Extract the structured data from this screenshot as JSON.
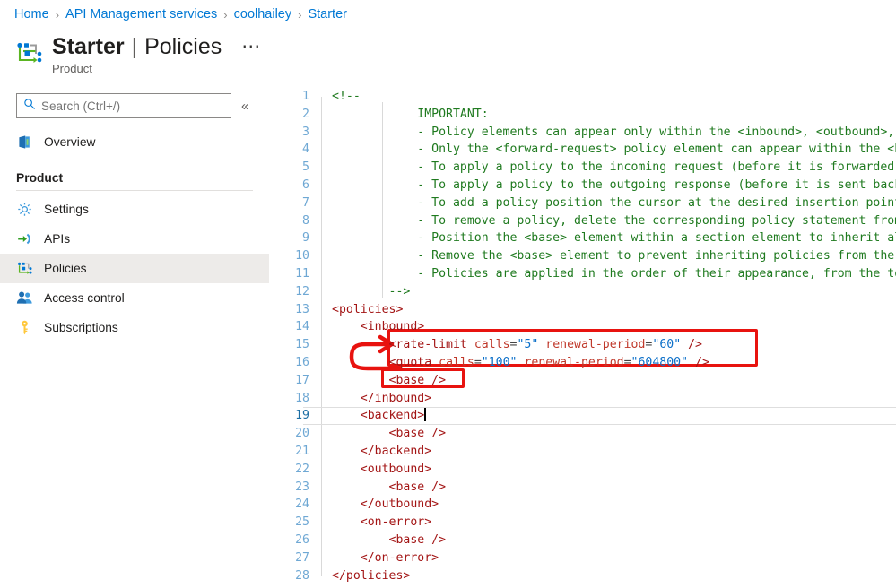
{
  "breadcrumb": {
    "separator": "›",
    "items": [
      {
        "label": "Home"
      },
      {
        "label": "API Management services"
      },
      {
        "label": "coolhailey"
      },
      {
        "label": "Starter"
      }
    ]
  },
  "header": {
    "icon": "policies-icon",
    "resource_name": "Starter",
    "pipe": "|",
    "page_name": "Policies",
    "ellipsis": "⋯",
    "subtitle": "Product"
  },
  "sidebar": {
    "search": {
      "icon": "search-icon",
      "placeholder": "Search (Ctrl+/)",
      "value": ""
    },
    "collapse": {
      "icon": "chevron-double-left-icon",
      "glyph": "«"
    },
    "top_items": [
      {
        "label": "Overview",
        "icon": "overview-icon",
        "selected": false
      }
    ],
    "group_title": "Product",
    "items": [
      {
        "label": "Settings",
        "icon": "gear-icon",
        "selected": false
      },
      {
        "label": "APIs",
        "icon": "apis-arrow-icon",
        "selected": false
      },
      {
        "label": "Policies",
        "icon": "policies-icon",
        "selected": true
      },
      {
        "label": "Access control",
        "icon": "people-icon",
        "selected": false
      },
      {
        "label": "Subscriptions",
        "icon": "key-icon",
        "selected": false
      }
    ]
  },
  "editor": {
    "active_line": 19,
    "caret_line": 19,
    "lines": [
      {
        "n": 1,
        "segments": [
          {
            "t": "comment",
            "s": "<!--"
          }
        ]
      },
      {
        "n": 2,
        "segments": [
          {
            "t": "comment",
            "s": "            IMPORTANT:"
          }
        ]
      },
      {
        "n": 3,
        "segments": [
          {
            "t": "comment",
            "s": "            - Policy elements can appear only within the <inbound>, <outbound>, <backend> section elements."
          }
        ]
      },
      {
        "n": 4,
        "segments": [
          {
            "t": "comment",
            "s": "            - Only the <forward-request> policy element can appear within the <backend> section element."
          }
        ]
      },
      {
        "n": 5,
        "segments": [
          {
            "t": "comment",
            "s": "            - To apply a policy to the incoming request (before it is forwarded to the backend service), place a corresponding policy element within the <inbound> section element."
          }
        ]
      },
      {
        "n": 6,
        "segments": [
          {
            "t": "comment",
            "s": "            - To apply a policy to the outgoing response (before it is sent back to the caller), place a corresponding policy element within the <outbound> section element."
          }
        ]
      },
      {
        "n": 7,
        "segments": [
          {
            "t": "comment",
            "s": "            - To add a policy position the cursor at the desired insertion point and click on the round button associated with the policy."
          }
        ]
      },
      {
        "n": 8,
        "segments": [
          {
            "t": "comment",
            "s": "            - To remove a policy, delete the corresponding policy statement from the policy document."
          }
        ]
      },
      {
        "n": 9,
        "segments": [
          {
            "t": "comment",
            "s": "            - Position the <base> element within a section element to inherit all policies from the corresponding section element in the enclosing scope."
          }
        ]
      },
      {
        "n": 10,
        "segments": [
          {
            "t": "comment",
            "s": "            - Remove the <base> element to prevent inheriting policies from the corresponding section element in the enclosing scope."
          }
        ]
      },
      {
        "n": 11,
        "segments": [
          {
            "t": "comment",
            "s": "            - Policies are applied in the order of their appearance, from the top down."
          }
        ]
      },
      {
        "n": 12,
        "segments": [
          {
            "t": "comment",
            "s": "        -->"
          }
        ]
      },
      {
        "n": 13,
        "segments": [
          {
            "t": "tag",
            "s": "<policies>"
          }
        ]
      },
      {
        "n": 14,
        "segments": [
          {
            "t": "plain",
            "s": "    "
          },
          {
            "t": "tag",
            "s": "<inbound>"
          }
        ]
      },
      {
        "n": 15,
        "segments": [
          {
            "t": "plain",
            "s": "        "
          },
          {
            "t": "tag",
            "s": "<rate-limit"
          },
          {
            "t": "plain",
            "s": " "
          },
          {
            "t": "attr",
            "s": "calls"
          },
          {
            "t": "punct",
            "s": "="
          },
          {
            "t": "val",
            "s": "\"5\""
          },
          {
            "t": "plain",
            "s": " "
          },
          {
            "t": "attr",
            "s": "renewal-period"
          },
          {
            "t": "punct",
            "s": "="
          },
          {
            "t": "val",
            "s": "\"60\""
          },
          {
            "t": "plain",
            "s": " "
          },
          {
            "t": "tag",
            "s": "/>"
          }
        ]
      },
      {
        "n": 16,
        "segments": [
          {
            "t": "plain",
            "s": "        "
          },
          {
            "t": "tag",
            "s": "<quota"
          },
          {
            "t": "plain",
            "s": " "
          },
          {
            "t": "attr",
            "s": "calls"
          },
          {
            "t": "punct",
            "s": "="
          },
          {
            "t": "val",
            "s": "\"100\""
          },
          {
            "t": "plain",
            "s": " "
          },
          {
            "t": "attr",
            "s": "renewal-period"
          },
          {
            "t": "punct",
            "s": "="
          },
          {
            "t": "val",
            "s": "\"604800\""
          },
          {
            "t": "plain",
            "s": " "
          },
          {
            "t": "tag",
            "s": "/>"
          }
        ]
      },
      {
        "n": 17,
        "segments": [
          {
            "t": "plain",
            "s": "        "
          },
          {
            "t": "tag",
            "s": "<base />"
          }
        ]
      },
      {
        "n": 18,
        "segments": [
          {
            "t": "plain",
            "s": "    "
          },
          {
            "t": "tag",
            "s": "</inbound>"
          }
        ]
      },
      {
        "n": 19,
        "segments": [
          {
            "t": "plain",
            "s": "    "
          },
          {
            "t": "tag",
            "s": "<backend>"
          }
        ]
      },
      {
        "n": 20,
        "segments": [
          {
            "t": "plain",
            "s": "        "
          },
          {
            "t": "tag",
            "s": "<base />"
          }
        ]
      },
      {
        "n": 21,
        "segments": [
          {
            "t": "plain",
            "s": "    "
          },
          {
            "t": "tag",
            "s": "</backend>"
          }
        ]
      },
      {
        "n": 22,
        "segments": [
          {
            "t": "plain",
            "s": "    "
          },
          {
            "t": "tag",
            "s": "<outbound>"
          }
        ]
      },
      {
        "n": 23,
        "segments": [
          {
            "t": "plain",
            "s": "        "
          },
          {
            "t": "tag",
            "s": "<base />"
          }
        ]
      },
      {
        "n": 24,
        "segments": [
          {
            "t": "plain",
            "s": "    "
          },
          {
            "t": "tag",
            "s": "</outbound>"
          }
        ]
      },
      {
        "n": 25,
        "segments": [
          {
            "t": "plain",
            "s": "    "
          },
          {
            "t": "tag",
            "s": "<on-error>"
          }
        ]
      },
      {
        "n": 26,
        "segments": [
          {
            "t": "plain",
            "s": "        "
          },
          {
            "t": "tag",
            "s": "<base />"
          }
        ]
      },
      {
        "n": 27,
        "segments": [
          {
            "t": "plain",
            "s": "    "
          },
          {
            "t": "tag",
            "s": "</on-error>"
          }
        ]
      },
      {
        "n": 28,
        "segments": [
          {
            "t": "tag",
            "s": "</policies>"
          }
        ]
      }
    ]
  },
  "annotations": {
    "color": "#e8130f",
    "shapes": [
      {
        "name": "highlight-box-rate-limit-quota",
        "kind": "rect"
      },
      {
        "name": "highlight-box-base",
        "kind": "rect"
      },
      {
        "name": "pointer-arrow",
        "kind": "arrow"
      }
    ]
  },
  "colors": {
    "link": "#0078d4",
    "accent": "#0078d4",
    "selected_nav_bg": "#edebe9",
    "comment_green": "#1f7a1f",
    "tag_red": "#a31515",
    "value_blue": "#0b6fc9",
    "annotation_red": "#e8130f"
  }
}
